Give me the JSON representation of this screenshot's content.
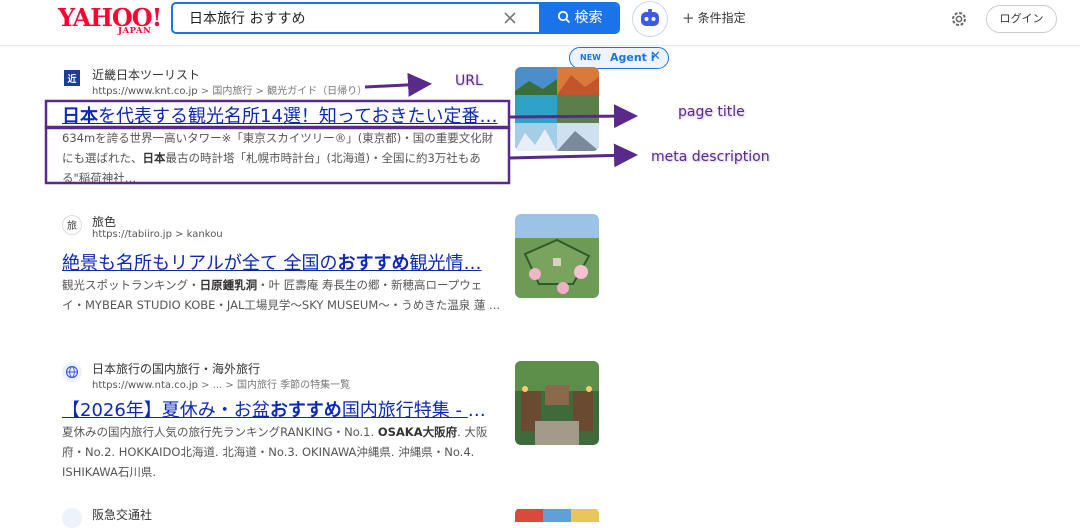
{
  "header": {
    "logo_text": "YAHOO!",
    "logo_sub": "JAPAN",
    "search_value": "日本旅行 おすすめ",
    "search_button": "検索",
    "filter_label": "条件指定",
    "login_label": "ログイン",
    "agent_new": "NEW",
    "agent_name": "Agent i"
  },
  "results": [
    {
      "site_name": "近畿日本ツーリスト",
      "url": "https://www.knt.co.jp",
      "breadcrumb": " > 国内旅行 > 観光ガイド（日帰り）",
      "title_strong": "日本",
      "title_rest": "を代表する観光名所14選！知っておきたい定番…",
      "desc_1": "634mを誇る世界一高いタワー※「東京スカイツリー®」(東京都)・国の重要文化財にも選ばれた、",
      "desc_strong": "日本",
      "desc_2": "最古の時計塔「札幌市時計台」(北海道)・全国に約3万社もある\"稲荷神社…"
    },
    {
      "site_name": "旅色",
      "url": "https://tabiiro.jp",
      "breadcrumb": " > kankou",
      "title_1": "絶景も名所もリアルが全て 全国の",
      "title_strong": "おすすめ",
      "title_2": "観光情…",
      "desc_1": "観光スポットランキング・",
      "desc_strong": "日原鍾乳洞",
      "desc_2": "・叶 匠壽庵 寿長生の郷・新穂高ロープウェイ・MYBEAR STUDIO KOBE・JAL工場見学〜SKY MUSEUM〜・うめきた温泉 蓮 ..."
    },
    {
      "site_name": "日本旅行の国内旅行・海外旅行",
      "url": "https://www.nta.co.jp",
      "breadcrumb": " > ... > 国内旅行 季節の特集一覧",
      "title_1": "【2026年】夏休み・お盆",
      "title_strong": "おすすめ",
      "title_2": "国内旅行特集 - 日…",
      "desc_1": "夏休みの国内旅行人気の旅行先ランキングRANKING・No.1. ",
      "desc_strong": "OSAKA大阪府",
      "desc_2": ". 大阪府・No.2. HOKKAIDO北海道. 北海道・No.3. OKINAWA沖縄県. 沖縄県・No.4. ISHIKAWA石川県."
    },
    {
      "site_name": "阪急交通社"
    }
  ],
  "annotations": {
    "url": "URL",
    "page_title": "page title",
    "meta_description": "meta description"
  },
  "colors": {
    "accent": "#1a73e8",
    "link": "#0b28b8",
    "annotation": "#5a2a8a",
    "brand": "#ff0033"
  }
}
